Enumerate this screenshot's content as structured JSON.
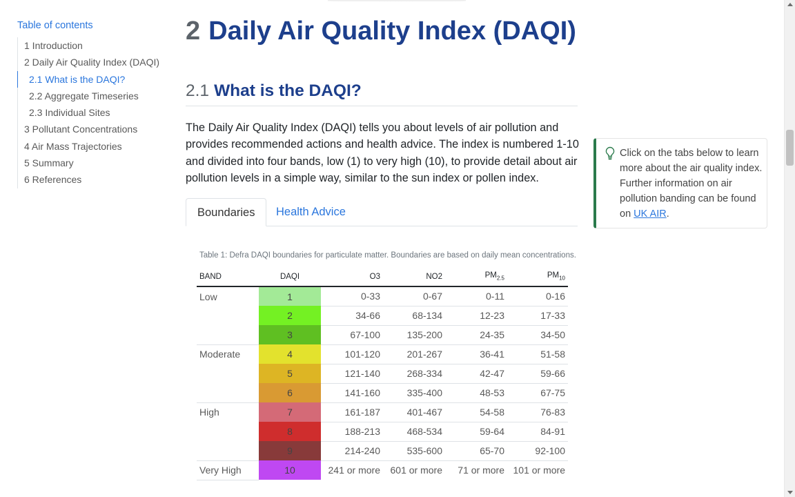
{
  "toc": {
    "title": "Table of contents",
    "items": [
      {
        "label": "1 Introduction"
      },
      {
        "label": "2 Daily Air Quality Index (DAQI)"
      },
      {
        "label": "2.1 What is the DAQI?"
      },
      {
        "label": "2.2 Aggregate Timeseries"
      },
      {
        "label": "2.3 Individual Sites"
      },
      {
        "label": "3 Pollutant Concentrations"
      },
      {
        "label": "4 Air Mass Trajectories"
      },
      {
        "label": "5 Summary"
      },
      {
        "label": "6 References"
      }
    ]
  },
  "heading1": {
    "number": "2",
    "title": "Daily Air Quality Index (DAQI)"
  },
  "heading2": {
    "number": "2.1",
    "title": "What is the DAQI?"
  },
  "paragraph": "The Daily Air Quality Index (DAQI) tells you about levels of air pollution and provides recommended actions and health advice. The index is numbered 1-10 and divided into four bands, low (1) to very high (10), to provide detail about air pollution levels in a simple way, similar to the sun index or pollen index.",
  "tabs": {
    "active": "Boundaries",
    "other": "Health Advice"
  },
  "table": {
    "caption": "Table 1: Defra DAQI boundaries for particulate matter. Boundaries are based on daily mean concentrations.",
    "headers": {
      "band": "BAND",
      "daqi": "DAQI",
      "o3": "O3",
      "no2": "NO2",
      "pm25_base": "PM",
      "pm25_sub": "2.5",
      "pm10_base": "PM",
      "pm10_sub": "10"
    },
    "rows": [
      {
        "band": "Low",
        "daqi": "1",
        "color": "#a3ea97",
        "o3": "0-33",
        "no2": "0-67",
        "pm25": "0-11",
        "pm10": "0-16"
      },
      {
        "band": "",
        "daqi": "2",
        "color": "#74f123",
        "o3": "34-66",
        "no2": "68-134",
        "pm25": "12-23",
        "pm10": "17-33"
      },
      {
        "band": "",
        "daqi": "3",
        "color": "#5fbf22",
        "o3": "67-100",
        "no2": "135-200",
        "pm25": "24-35",
        "pm10": "34-50"
      },
      {
        "band": "Moderate",
        "daqi": "4",
        "color": "#e3e22d",
        "o3": "101-120",
        "no2": "201-267",
        "pm25": "36-41",
        "pm10": "51-58"
      },
      {
        "band": "",
        "daqi": "5",
        "color": "#ddb524",
        "o3": "121-140",
        "no2": "268-334",
        "pm25": "42-47",
        "pm10": "59-66"
      },
      {
        "band": "",
        "daqi": "6",
        "color": "#d99a33",
        "o3": "141-160",
        "no2": "335-400",
        "pm25": "48-53",
        "pm10": "67-75"
      },
      {
        "band": "High",
        "daqi": "7",
        "color": "#d46a77",
        "o3": "161-187",
        "no2": "401-467",
        "pm25": "54-58",
        "pm10": "76-83"
      },
      {
        "band": "",
        "daqi": "8",
        "color": "#cf2d2d",
        "o3": "188-213",
        "no2": "468-534",
        "pm25": "59-64",
        "pm10": "84-91"
      },
      {
        "band": "",
        "daqi": "9",
        "color": "#883a3a",
        "o3": "214-240",
        "no2": "535-600",
        "pm25": "65-70",
        "pm10": "92-100"
      },
      {
        "band": "Very High",
        "daqi": "10",
        "color": "#bf48f2",
        "o3": "241 or more",
        "no2": "601 or more",
        "pm25": "71 or more",
        "pm10": "101 or more"
      }
    ]
  },
  "callout": {
    "text": "Click on the tabs below to learn more about the air quality index. Further information on air pollution banding can be found on ",
    "link": "UK AIR",
    "suffix": "."
  },
  "colors": {
    "accent": "#2a76dd",
    "heading": "#1d3f8c",
    "callout_border": "#2a7a4b"
  }
}
